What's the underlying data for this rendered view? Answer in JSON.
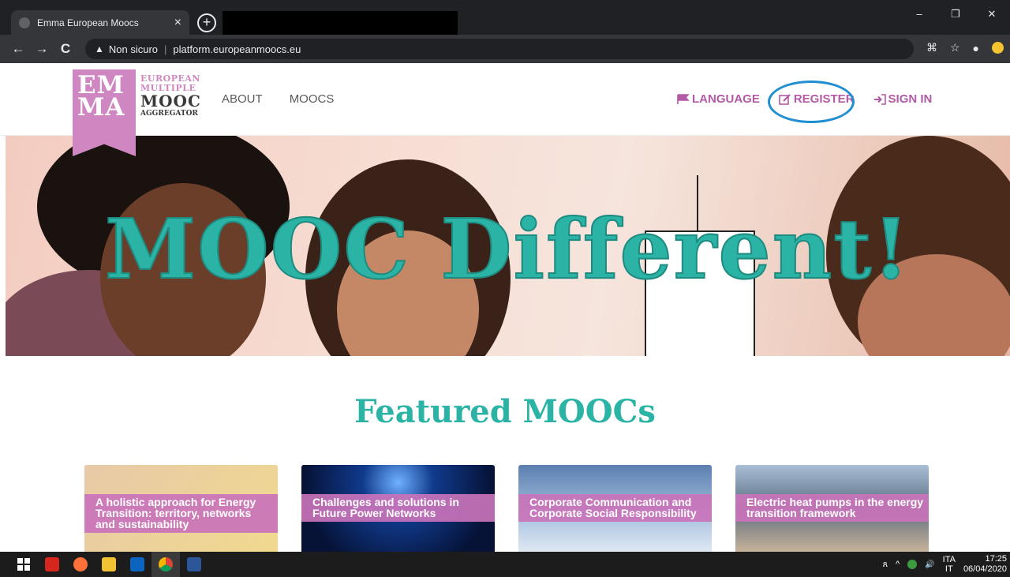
{
  "browser": {
    "tab_title": "Emma European Moocs",
    "tab_close": "×",
    "new_tab": "+",
    "security": "Non sicuro",
    "url": "platform.europeanmoocs.eu",
    "win_min": "–",
    "win_restore": "❐",
    "win_close": "✕",
    "back": "←",
    "forward": "→",
    "reload": "C",
    "warn_icon": "▲",
    "translate": "⌘",
    "star": "☆",
    "profile": "●"
  },
  "site": {
    "logo_line1": "EM",
    "logo_line2": "MA",
    "logo_small1": "EUROPEAN",
    "logo_small2": "MULTIPLE",
    "logo_big": "MOOC",
    "logo_small3": "AGGREGATOR",
    "nav_about": "ABOUT",
    "nav_moocs": "MOOCS",
    "nav_language": "LANGUAGE",
    "nav_register": "REGISTER",
    "nav_signin": "SIGN IN",
    "hero_title": "MOOC Different!",
    "featured_title": "Featured MOOCs",
    "accent_color": "#cf87c1",
    "teal_color": "#2bb3a5"
  },
  "cards": [
    {
      "title": "A holistic approach for Energy Transition: territory, networks and sustainability"
    },
    {
      "title": "Challenges and solutions in Future Power Networks"
    },
    {
      "title": "Corporate Communication and Corporate Social Responsibility"
    },
    {
      "title": "Electric heat pumps in the energy transition framework"
    }
  ],
  "taskbar": {
    "lang_top": "ITA",
    "lang_bottom": "IT",
    "time": "17:25",
    "date": "06/04/2020",
    "tray_chevron": "^",
    "tray_volume": "🔊",
    "tray_people": "ጸ"
  }
}
